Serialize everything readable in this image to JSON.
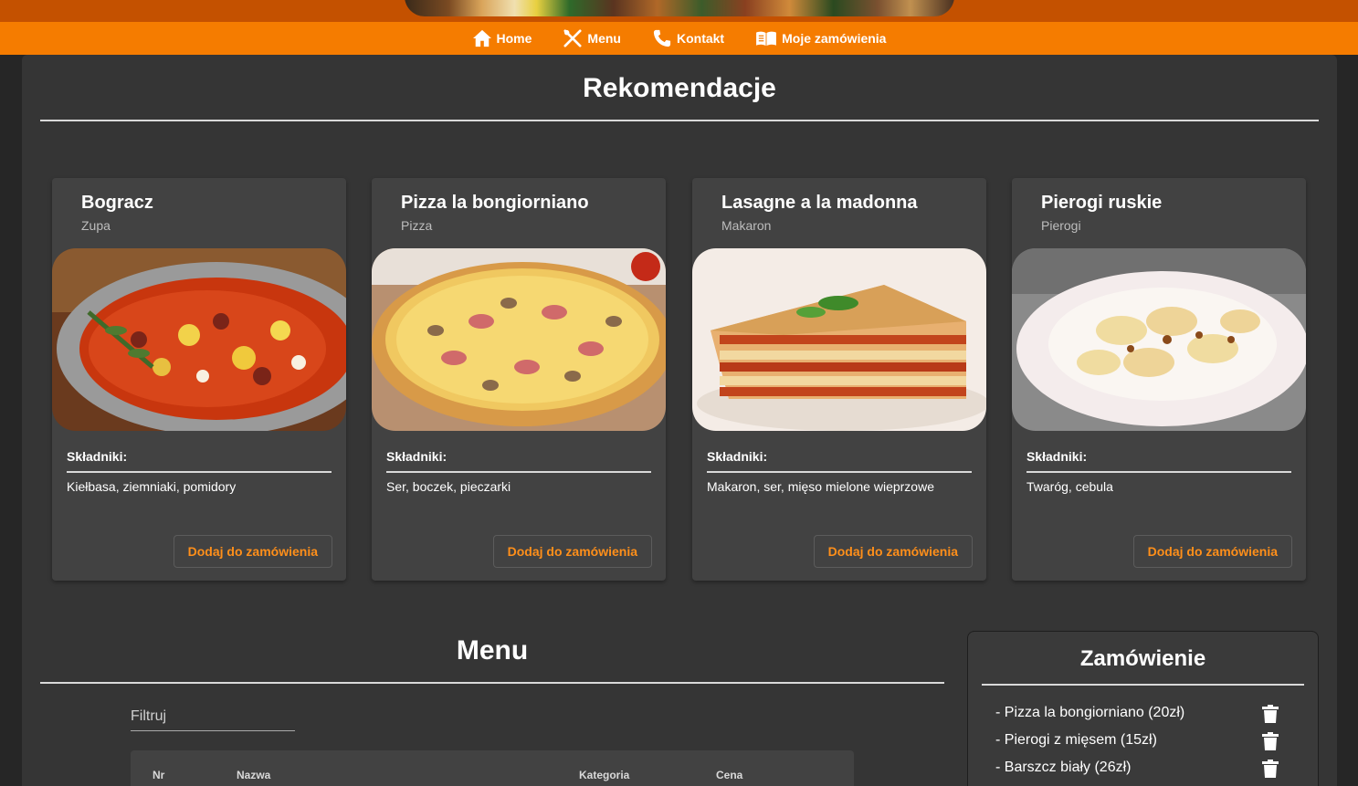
{
  "nav": {
    "items": [
      {
        "label": "Home",
        "icon": "home-icon"
      },
      {
        "label": "Menu",
        "icon": "cutlery-icon"
      },
      {
        "label": "Kontakt",
        "icon": "phone-icon"
      },
      {
        "label": "Moje zamówienia",
        "icon": "book-icon"
      }
    ]
  },
  "recommendations": {
    "title": "Rekomendacje",
    "ingredients_label": "Składniki:",
    "add_button": "Dodaj do zamówienia",
    "cards": [
      {
        "name": "Bogracz",
        "category": "Zupa",
        "ingredients": "Kiełbasa, ziemniaki, pomidory"
      },
      {
        "name": "Pizza la bongiorniano",
        "category": "Pizza",
        "ingredients": "Ser, boczek, pieczarki"
      },
      {
        "name": "Lasagne a la madonna",
        "category": "Makaron",
        "ingredients": "Makaron, ser, mięso mielone wieprzowe"
      },
      {
        "name": "Pierogi ruskie",
        "category": "Pierogi",
        "ingredients": "Twaróg, cebula"
      }
    ]
  },
  "menu": {
    "title": "Menu",
    "filter_placeholder": "Filtruj",
    "columns": [
      "Nr",
      "Nazwa",
      "Kategoria",
      "Cena"
    ]
  },
  "order": {
    "title": "Zamówienie",
    "items": [
      "- Pizza la bongiorniano (20zł)",
      "- Pierogi z mięsem (15zł)",
      "- Barszcz biały (26zł)"
    ]
  },
  "colors": {
    "accent": "#f57c00",
    "banner": "#c45100",
    "panel": "#353535",
    "card": "#424242",
    "button_text": "#ff8f1a"
  }
}
